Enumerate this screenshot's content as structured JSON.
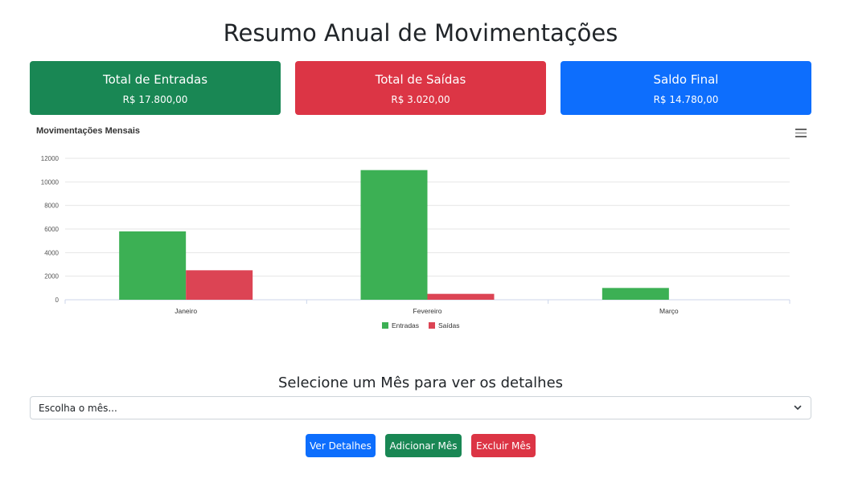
{
  "page": {
    "title": "Resumo Anual de Movimentações"
  },
  "cards": {
    "entradas": {
      "label": "Total de Entradas",
      "value": "R$ 17.800,00",
      "color": "#198754"
    },
    "saidas": {
      "label": "Total de Saídas",
      "value": "R$ 3.020,00",
      "color": "#dc3545"
    },
    "saldo": {
      "label": "Saldo Final",
      "value": "R$ 14.780,00",
      "color": "#0d6efd"
    }
  },
  "chart_data": {
    "type": "bar",
    "title": "Movimentações Mensais",
    "categories": [
      "Janeiro",
      "Fevereiro",
      "Março"
    ],
    "series": [
      {
        "name": "Entradas",
        "values": [
          5800,
          11000,
          1000
        ],
        "color": "#3cb054"
      },
      {
        "name": "Saídas",
        "values": [
          2500,
          500,
          0
        ],
        "color": "#dc4454"
      }
    ],
    "ylim": [
      0,
      12000
    ],
    "yticks": [
      0,
      2000,
      4000,
      6000,
      8000,
      10000,
      12000
    ],
    "grid": true,
    "legend": "bottom",
    "menu_icon": "hamburger-menu-icon"
  },
  "detail": {
    "title": "Selecione um Mês para ver os detalhes",
    "select_value": "Escolha o mês...",
    "select_icon": "chevron-down-icon"
  },
  "buttons": {
    "view": "Ver Detalhes",
    "add": "Adicionar Mês",
    "delete": "Excluir Mês"
  }
}
